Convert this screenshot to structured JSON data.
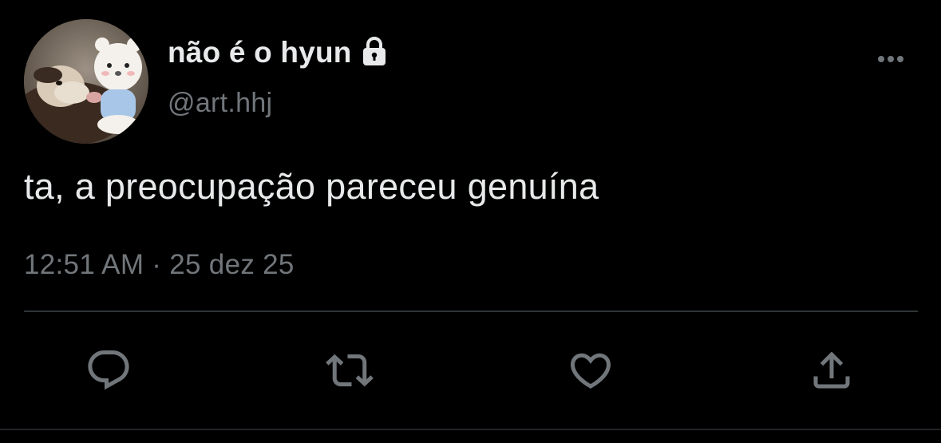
{
  "user": {
    "display_name": "não é o hyun",
    "handle": "@art.hhj",
    "protected_icon": "lock-icon",
    "avatar_icon": "avatar"
  },
  "tweet": {
    "text": "ta, a preocupação pareceu genuína",
    "time": "12:51 AM",
    "separator": "·",
    "date": "25 dez 25"
  },
  "actions": [
    {
      "name": "reply",
      "icon": "reply-icon"
    },
    {
      "name": "retweet",
      "icon": "retweet-icon"
    },
    {
      "name": "like",
      "icon": "heart-icon"
    },
    {
      "name": "share",
      "icon": "share-icon"
    }
  ],
  "menu": {
    "icon": "more-icon"
  },
  "colors": {
    "background": "#000000",
    "primary_text": "#e7e9ea",
    "secondary_text": "#71767b",
    "divider": "#2f3336"
  }
}
